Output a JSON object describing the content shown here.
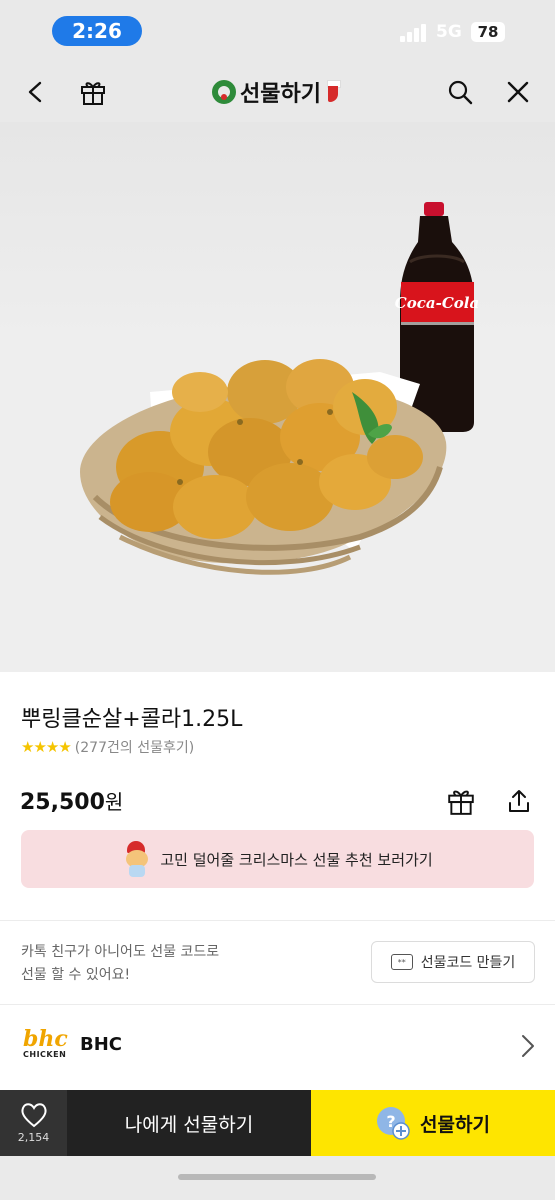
{
  "status_bar": {
    "time": "2:26",
    "network": "5G",
    "battery": "78"
  },
  "nav": {
    "title": "선물하기",
    "back_icon": "chevron-left-icon",
    "gift_icon": "gift-icon",
    "search_icon": "search-icon",
    "close_icon": "close-icon"
  },
  "product": {
    "name": "뿌링클순살+콜라1.25L",
    "rating_stars": 4,
    "review_text": "(277건의 선물후기)",
    "price": "25,500",
    "price_unit": "원",
    "brand_drink_label": "Coca-Cola"
  },
  "xmas_banner": {
    "text": "고민 덜어줄 크리스마스 선물 추천 보러가기"
  },
  "gift_code": {
    "line1": "카톡 친구가 아니어도 선물 코드로",
    "line2": "선물 할 수 있어요!",
    "button_label": "선물코드 만들기",
    "button_icon_text": "**"
  },
  "brand": {
    "logo_top": "bhc",
    "logo_bottom": "CHICKEN",
    "name": "BHC"
  },
  "bottom_bar": {
    "wish_count": "2,154",
    "self_gift_label": "나에게 선물하기",
    "gift_label": "선물하기"
  },
  "colors": {
    "kakao_yellow": "#fee500",
    "star": "#f5c400",
    "banner_pink": "#f8dde0",
    "status_pill": "#1f7ae8"
  }
}
